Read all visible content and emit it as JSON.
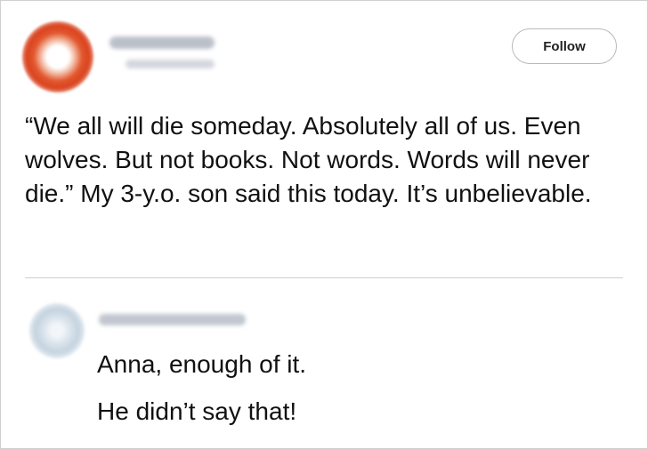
{
  "tweet": {
    "follow_label": "Follow",
    "text": "“We all will die someday. Absolutely all of us. Even wolves. But not books. Not words. Words will never die.” My 3-y.o. son said this today. It’s unbelievable."
  },
  "reply": {
    "lines": [
      "Anna, enough of it.",
      "He didn’t say that!"
    ]
  },
  "colors": {
    "avatar_main": "#d9431f",
    "avatar_reply": "#c4d3df",
    "divider": "#cfcfcf"
  }
}
